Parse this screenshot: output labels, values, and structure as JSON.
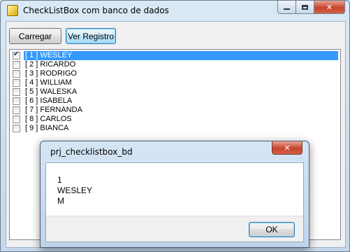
{
  "window": {
    "title": "CheckListBox com banco de dados"
  },
  "toolbar": {
    "load_label": "Carregar",
    "view_label": "Ver Registro"
  },
  "list": {
    "items": [
      {
        "label": "[ 1 ] WESLEY",
        "checked": true,
        "selected": true
      },
      {
        "label": "[ 2 ] RICARDO",
        "checked": false,
        "selected": false
      },
      {
        "label": "[ 3 ] RODRIGO",
        "checked": false,
        "selected": false
      },
      {
        "label": "[ 4 ] WILLIAM",
        "checked": false,
        "selected": false
      },
      {
        "label": "[ 5 ] WALESKA",
        "checked": false,
        "selected": false
      },
      {
        "label": "[ 6 ] ISABELA",
        "checked": false,
        "selected": false
      },
      {
        "label": "[ 7 ] FERNANDA",
        "checked": false,
        "selected": false
      },
      {
        "label": "[ 8 ] CARLOS",
        "checked": false,
        "selected": false
      },
      {
        "label": "[ 9 ] BIANCA",
        "checked": false,
        "selected": false
      }
    ]
  },
  "dialog": {
    "title": "prj_checklistbox_bd",
    "lines": [
      "1",
      "WESLEY",
      "M"
    ],
    "ok_label": "OK"
  },
  "icons": {
    "app": "app-icon",
    "minimize": "minimize-icon",
    "maximize": "maximize-icon",
    "close": "close-icon",
    "check": "checkmark-icon"
  },
  "colors": {
    "selection": "#3399ff",
    "close_button": "#c7452c"
  }
}
